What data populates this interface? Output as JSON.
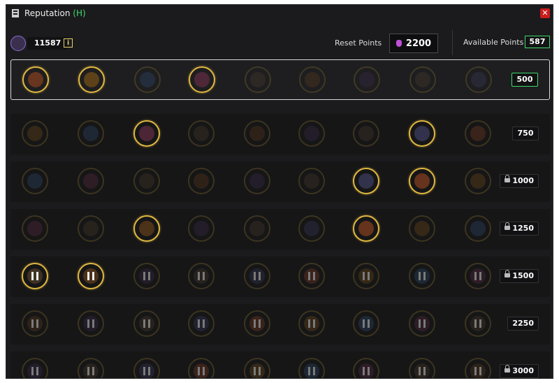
{
  "window": {
    "title": "Reputation",
    "title_tag": "(H)",
    "close_label": "✕"
  },
  "player": {
    "reputation_value": "11587",
    "info_label": "i"
  },
  "reset": {
    "label": "Reset Points",
    "value": "2200"
  },
  "available": {
    "label": "Available Points",
    "value": "587"
  },
  "tiers": [
    {
      "cost": "500",
      "locked": false,
      "selected": true
    },
    {
      "cost": "750",
      "locked": false,
      "selected": false
    },
    {
      "cost": "1000",
      "locked": true,
      "selected": false
    },
    {
      "cost": "1250",
      "locked": true,
      "selected": false
    },
    {
      "cost": "1500",
      "locked": true,
      "selected": false
    },
    {
      "cost": "2250",
      "locked": false,
      "selected": false
    },
    {
      "cost": "3000",
      "locked": true,
      "selected": false
    }
  ],
  "colors": {
    "accent_green": "#3ddc6a",
    "gold_ring": "#e0b840",
    "close_red": "#c81e1e"
  }
}
